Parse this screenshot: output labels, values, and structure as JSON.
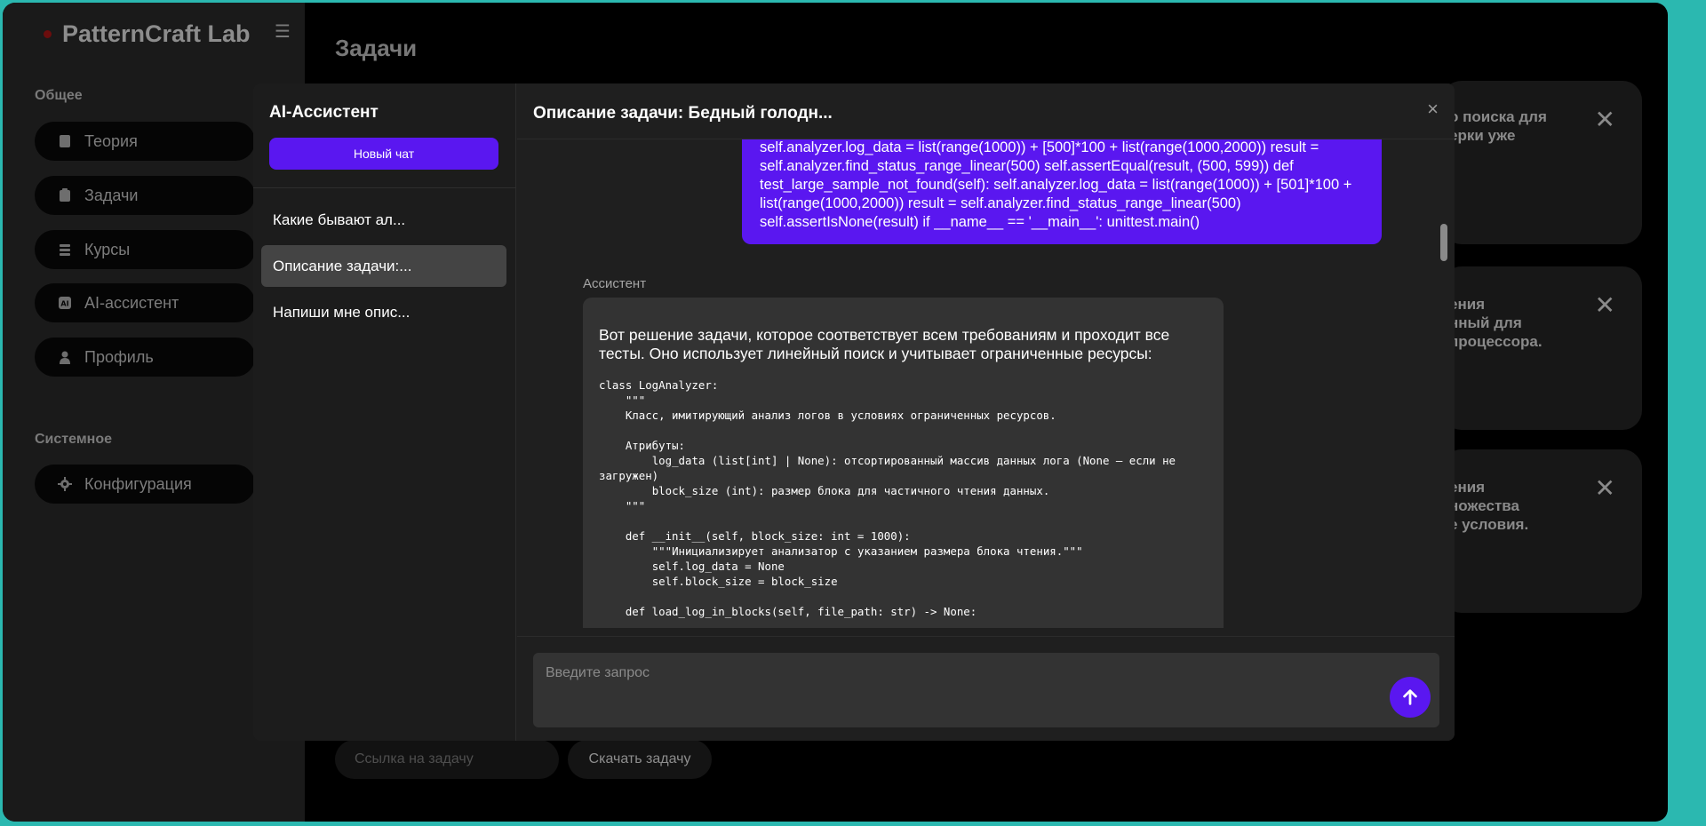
{
  "app": {
    "brand": "PatternCraft Lab"
  },
  "sidebar": {
    "group_general": "Общее",
    "group_system": "Системное",
    "items": [
      {
        "label": "Теория",
        "icon": "book-icon"
      },
      {
        "label": "Задачи",
        "icon": "clipboard-icon"
      },
      {
        "label": "Курсы",
        "icon": "layers-icon"
      },
      {
        "label": "AI-ассистент",
        "icon": "ai-icon"
      },
      {
        "label": "Профиль",
        "icon": "user-icon"
      }
    ],
    "config": {
      "label": "Конфигурация",
      "icon": "gear-icon"
    }
  },
  "main": {
    "title": "Задачи",
    "cards": [
      {
        "text": "о поиска для\nерки уже"
      },
      {
        "text": "ения\nнный для\nпроцессора."
      },
      {
        "text": "ения\nножества\nе условия."
      }
    ],
    "link_placeholder": "Ссылка на задачу",
    "download_label": "Скачать задачу"
  },
  "assistant": {
    "panel_title": "AI-Ассистент",
    "new_chat_label": "Новый чат",
    "chats": [
      {
        "label": "Какие бывают ал...",
        "active": false
      },
      {
        "label": "Описание задачи:...",
        "active": true
      },
      {
        "label": "Напиши мне опис...",
        "active": false
      }
    ],
    "chat_title": "Описание задачи: Бедный голодн...",
    "close_label": "×",
    "user_message": "self.analyzer.log_data = list(range(1000)) + [500]*100 + list(range(1000,2000)) result = self.analyzer.find_status_range_linear(500) self.assertEqual(result, (500, 599)) def test_large_sample_not_found(self): self.analyzer.log_data = list(range(1000)) + [501]*100 + list(range(1000,2000)) result = self.analyzer.find_status_range_linear(500) self.assertIsNone(result) if __name__ == '__main__': unittest.main()",
    "assistant_label": "Ассистент",
    "assistant_intro": "Вот решение задачи, которое соответствует всем требованиям и проходит все тесты. Оно использует линейный поиск и учитывает ограниченные ресурсы:",
    "assistant_code": "class LogAnalyzer:\n    \"\"\"\n    Класс, имитирующий анализ логов в условиях ограниченных ресурсов.\n\n    Атрибуты:\n        log_data (list[int] | None): отсортированный массив данных лога (None — если не загружен)\n        block_size (int): размер блока для частичного чтения данных.\n    \"\"\"\n\n    def __init__(self, block_size: int = 1000):\n        \"\"\"Инициализирует анализатор с указанием размера блока чтения.\"\"\"\n        self.log_data = None\n        self.block_size = block_size\n\n    def load_log_in_blocks(self, file_path: str) -> None:",
    "query_placeholder": "Введите запрос",
    "send_icon": "arrow-up-icon"
  },
  "colors": {
    "accent": "#5a17f0",
    "page_bg": "#000000",
    "outer_bg": "#2bb8b0"
  }
}
